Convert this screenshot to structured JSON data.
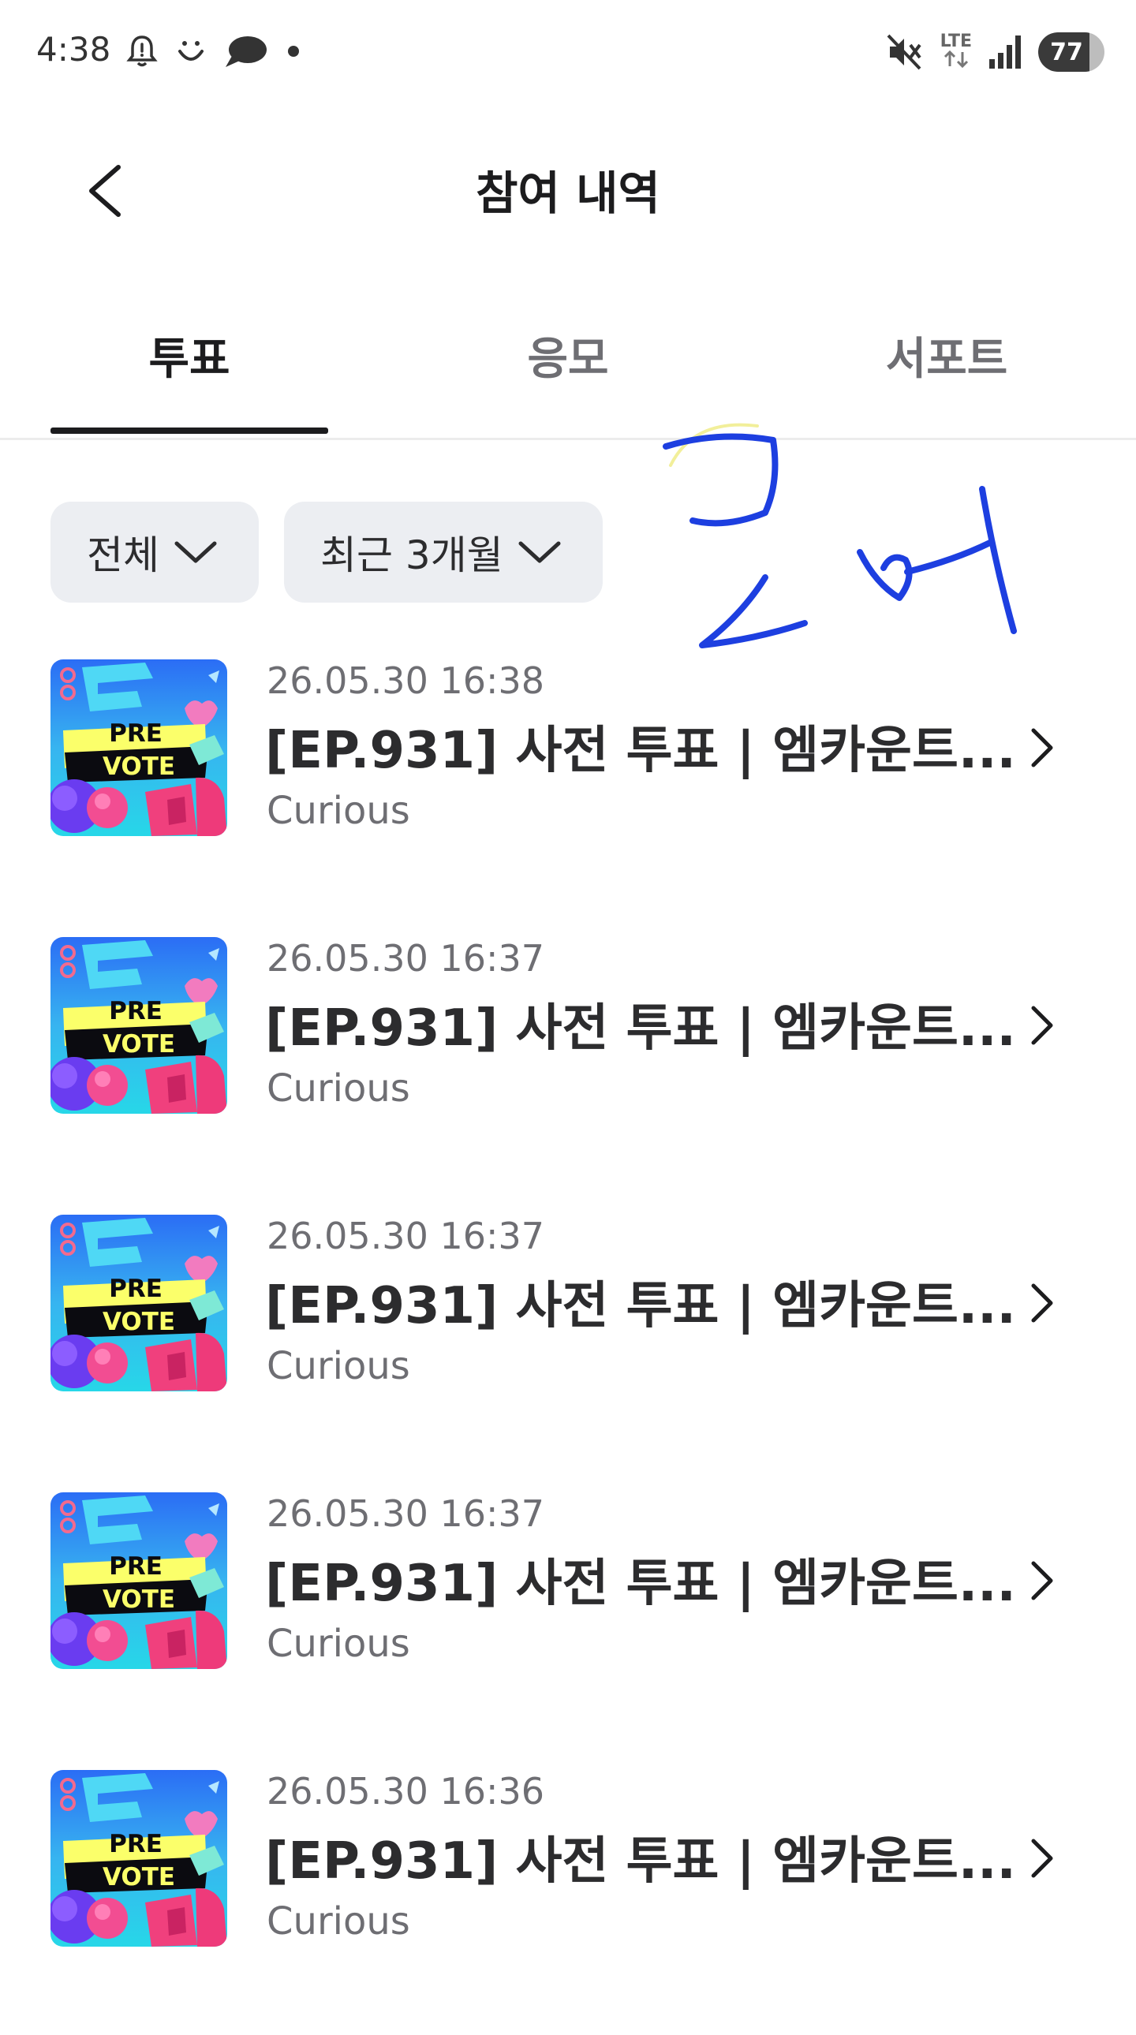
{
  "status_bar": {
    "time": "4:38",
    "network": "LTE",
    "battery_level": 77,
    "icons": [
      "alarm-icon",
      "smile-icon",
      "chat-bubble-icon",
      "dot-icon",
      "mute-icon",
      "lte-icon",
      "signal-icon",
      "battery-icon"
    ]
  },
  "header": {
    "title": "참여 내역",
    "back_icon": "back-arrow-icon"
  },
  "tabs": [
    {
      "label": "투표",
      "active": true
    },
    {
      "label": "응모",
      "active": false
    },
    {
      "label": "서포트",
      "active": false
    }
  ],
  "filters": [
    {
      "label": "전체"
    },
    {
      "label": "최근 3개월"
    }
  ],
  "thumbnail": {
    "line1": "PRE",
    "line2": "VOTE"
  },
  "items": [
    {
      "date": "26.05.30 16:38",
      "title": "[EP.931] 사전 투표 | 엠카운트...",
      "subtitle": "Curious"
    },
    {
      "date": "26.05.30 16:37",
      "title": "[EP.931] 사전 투표 | 엠카운트...",
      "subtitle": "Curious"
    },
    {
      "date": "26.05.30 16:37",
      "title": "[EP.931] 사전 투표 | 엠카운트...",
      "subtitle": "Curious"
    },
    {
      "date": "26.05.30 16:37",
      "title": "[EP.931] 사전 투표 | 엠카운트...",
      "subtitle": "Curious"
    },
    {
      "date": "26.05.30 16:36",
      "title": "[EP.931] 사전 투표 | 엠카운트...",
      "subtitle": "Curious"
    }
  ],
  "colors": {
    "accent_ink": "#1d3fe0",
    "text_primary": "#1c1c1e",
    "text_secondary": "#6e6e73",
    "chip_bg": "#eceef2"
  }
}
